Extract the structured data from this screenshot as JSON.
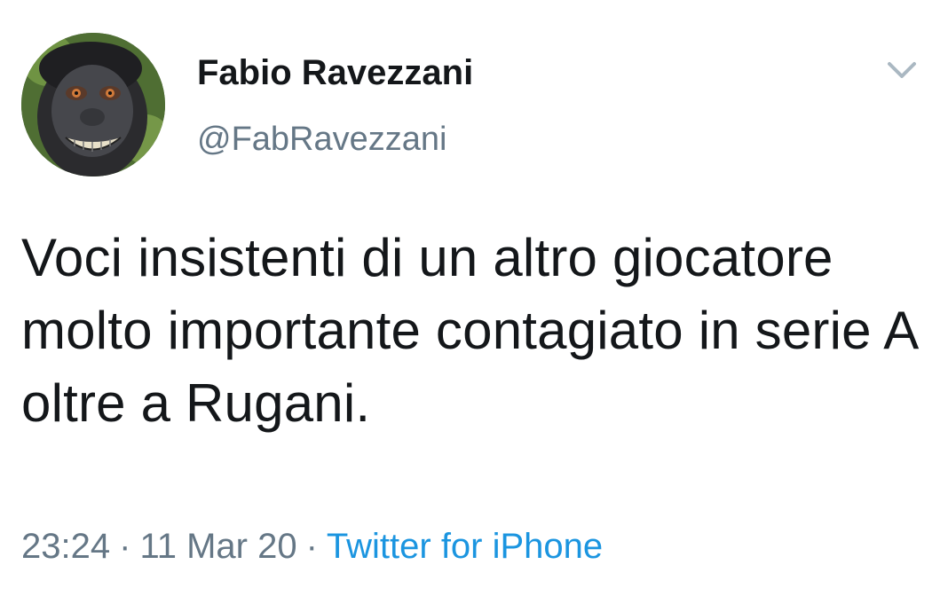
{
  "author": {
    "display_name": "Fabio Ravezzani",
    "handle": "@FabRavezzani",
    "avatar_icon": "monkey-selfie-avatar"
  },
  "menu": {
    "icon": "chevron-down-icon"
  },
  "tweet": {
    "text": "Voci insistenti di un altro giocatore molto importante contagiato in serie A oltre a Rugani."
  },
  "meta": {
    "time": "23:24",
    "separator": "·",
    "date": "11 Mar 20",
    "source": "Twitter for iPhone"
  },
  "colors": {
    "text_primary": "#14171a",
    "text_secondary": "#657786",
    "link": "#1b95e0"
  }
}
